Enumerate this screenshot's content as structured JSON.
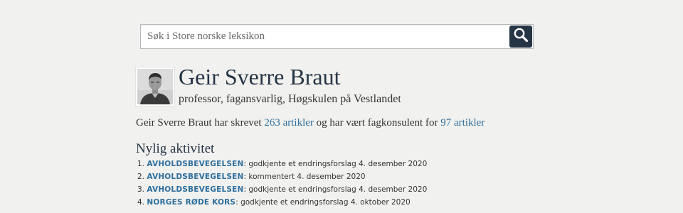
{
  "search": {
    "placeholder": "Søk i Store norske leksikon",
    "value": "",
    "button_icon": "search-icon"
  },
  "profile": {
    "name": "Geir Sverre Braut",
    "role": "professor, fagansvarlig, Høgskulen på Vestlandet",
    "avatar_icon": "person-photo"
  },
  "summary": {
    "text_before": "Geir Sverre Braut har skrevet ",
    "articles_written": "263 artikler",
    "text_middle": " og har vært fagkonsulent for ",
    "articles_consulted": "97 artikler"
  },
  "recent_activity": {
    "title": "Nylig aktivitet",
    "items": [
      {
        "number": "1.",
        "topic": "AVHOLDSBEVEGELSEN",
        "action": ": godkjente et endringsforslag 4. desember 2020"
      },
      {
        "number": "2.",
        "topic": "AVHOLDSBEVEGELSEN",
        "action": ": kommentert 4. desember 2020"
      },
      {
        "number": "3.",
        "topic": "AVHOLDSBEVEGELSEN",
        "action": ": godkjente et endringsforslag 4. desember 2020"
      },
      {
        "number": "4.",
        "topic": "NORGES RØDE KORS",
        "action": ": godkjente et endringsforslag 4. oktober 2020"
      }
    ]
  },
  "colors": {
    "background": "#f1f1ef",
    "heading": "#263545",
    "link": "#2e6f9e",
    "search_button": "#263545"
  }
}
